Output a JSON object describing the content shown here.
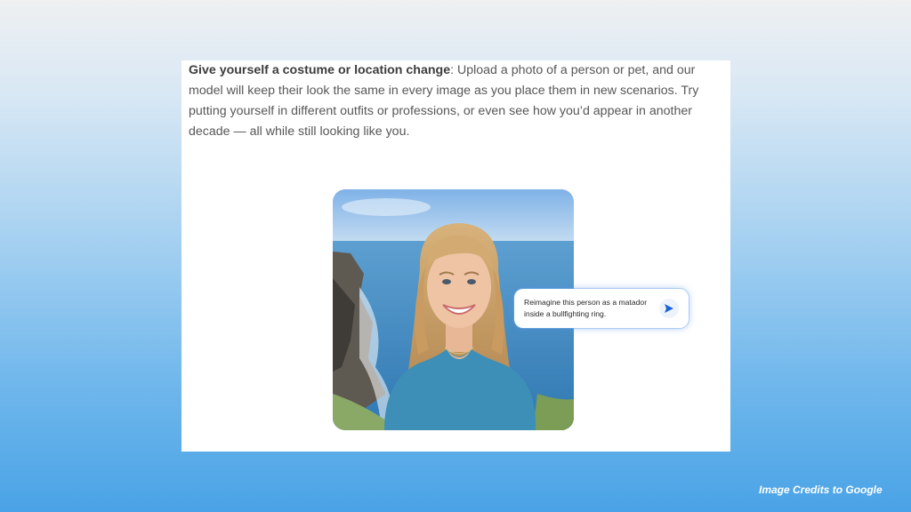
{
  "article": {
    "lead": "Give yourself a costume or location change",
    "body": ": Upload a photo of a person or pet, and our model will keep their look the same in every image as you place them in new scenarios. Try putting yourself in different outfits or professions, or even see how you’d appear in another decade — all while still looking like you."
  },
  "prompt": {
    "text": "Reimagine this person as a matador inside a bullfighting ring.",
    "send_icon": "send-arrow-icon"
  },
  "credits": "Image Credits to Google",
  "colors": {
    "page_background_top": "#eef0f2",
    "page_background_bottom": "#4aa3e6",
    "card": "#ffffff",
    "send_accent": "#1a63d6"
  }
}
